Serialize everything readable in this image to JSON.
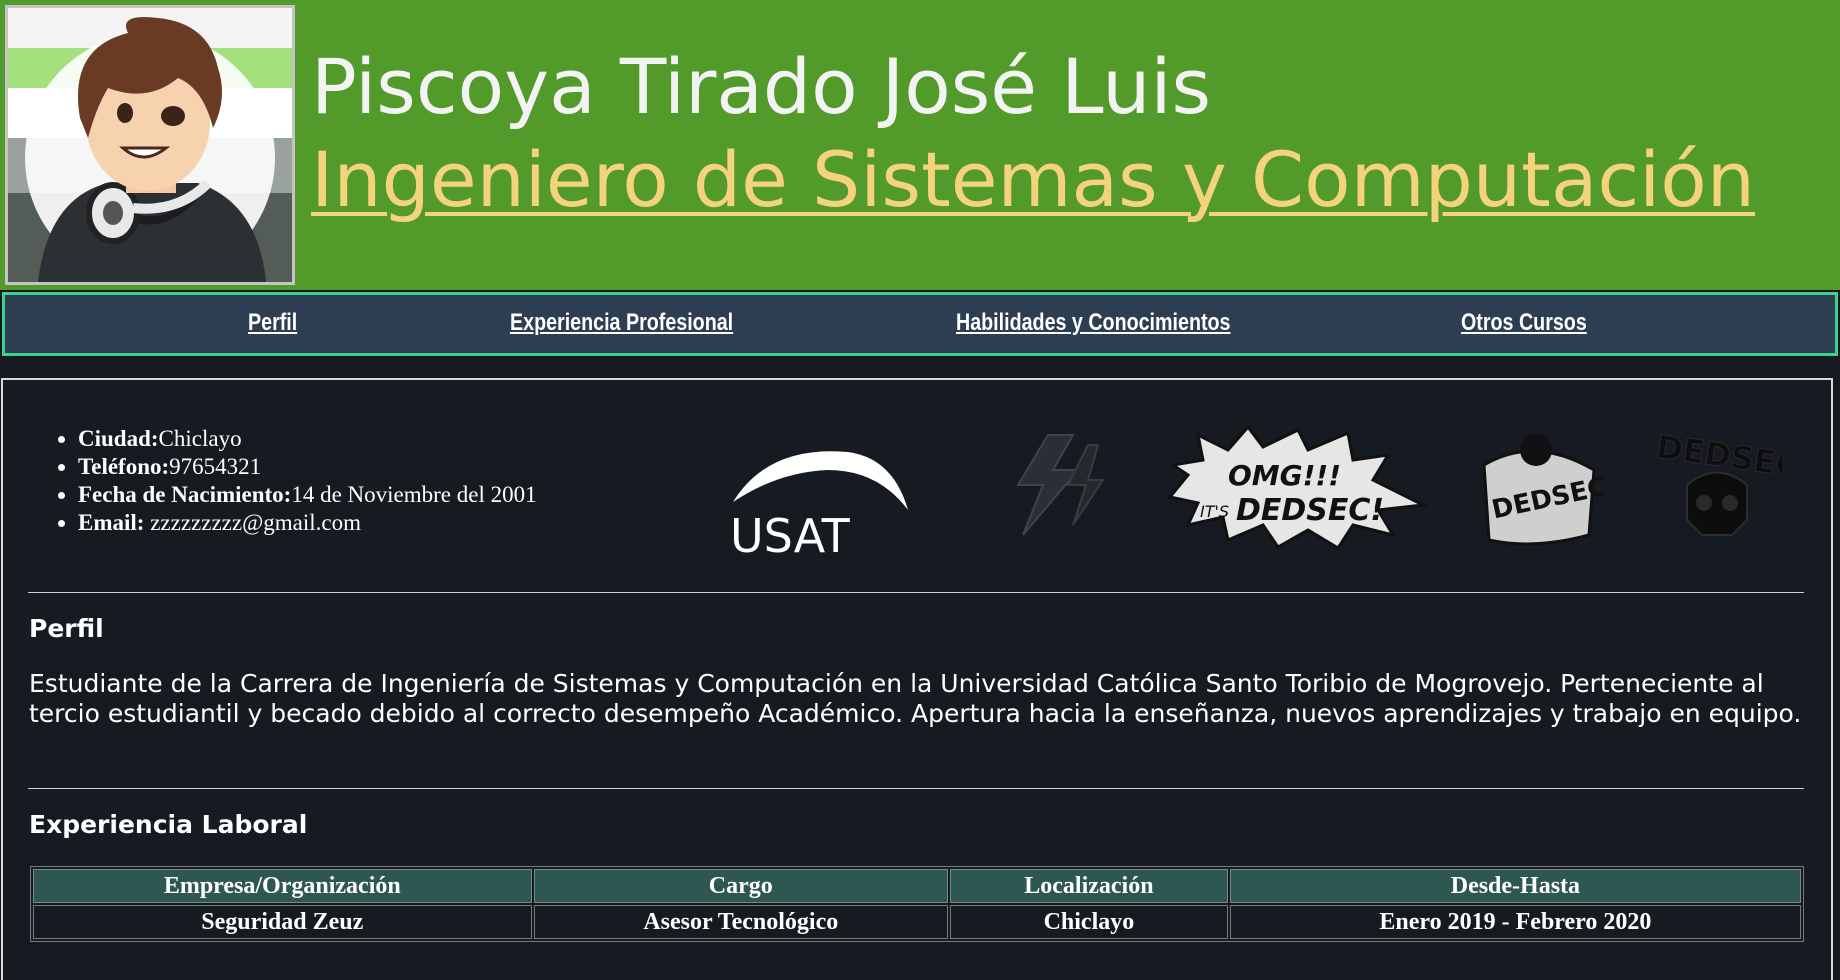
{
  "header": {
    "name": "Piscoya Tirado José Luis",
    "profession": "Ingeniero de Sistemas y Computación"
  },
  "nav": {
    "items": [
      {
        "label": "Perfil"
      },
      {
        "label": "Experiencia Profesional"
      },
      {
        "label": "Habilidades y Conocimientos"
      },
      {
        "label": "Otros Cursos"
      }
    ]
  },
  "info": {
    "items": [
      {
        "label": "Ciudad:",
        "value": "Chiclayo"
      },
      {
        "label": "Teléfono:",
        "value": "97654321"
      },
      {
        "label": "Fecha de Nacimiento:",
        "value": "14 de Noviembre del 2001"
      },
      {
        "label": "Email: ",
        "value": "zzzzzzzzz@gmail.com"
      }
    ]
  },
  "logos": {
    "usat": "USAT",
    "omg_line1": "OMG!!!",
    "omg_its": "IT'S",
    "omg_line2": "DEDSEC!",
    "dedsec_badge": "DEDSEC",
    "dedsec_skull": "DEDSEC"
  },
  "perfil": {
    "title": "Perfil",
    "text": "Estudiante de la Carrera de Ingeniería de Sistemas y Computación en la Universidad Católica Santo Toribio de Mogrovejo. Perteneciente al tercio estudiantil y becado debido al correcto desempeño Académico. Apertura hacia la enseñanza, nuevos aprendizajes y trabajo en equipo."
  },
  "experiencia": {
    "title": "Experiencia Laboral",
    "headers": [
      "Empresa/Organización",
      "Cargo",
      "Localización",
      "Desde-Hasta"
    ],
    "rows": [
      [
        "Seguridad Zeuz",
        "Asesor Tecnológico",
        "Chiclayo",
        "Enero 2019 - Febrero 2020"
      ]
    ]
  },
  "colors": {
    "header_bg": "#529a2a",
    "profession": "#f5d27c",
    "nav_bg": "#2d3e53",
    "nav_border": "#3fd08a",
    "page_bg": "#161b22",
    "table_header_bg": "#2e5752"
  }
}
